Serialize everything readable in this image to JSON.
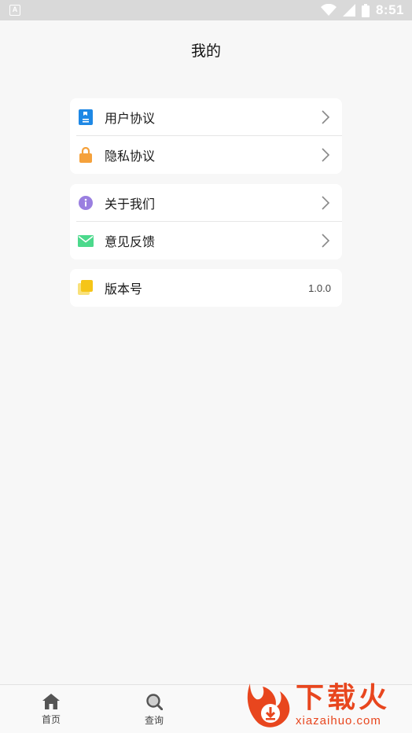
{
  "status_bar": {
    "time": "8:51",
    "icons": [
      "app-notification-icon",
      "wifi-icon",
      "cell-signal-icon",
      "battery-icon"
    ]
  },
  "page": {
    "title": "我的"
  },
  "menu_groups": [
    {
      "items": [
        {
          "label": "用户协议",
          "icon": "book-icon",
          "icon_color": "#1e88e5"
        },
        {
          "label": "隐私协议",
          "icon": "lock-icon",
          "icon_color": "#f5a13b"
        }
      ]
    },
    {
      "items": [
        {
          "label": "关于我们",
          "icon": "info-icon",
          "icon_color": "#9a7fe0"
        },
        {
          "label": "意见反馈",
          "icon": "mail-icon",
          "icon_color": "#4cd98c"
        }
      ]
    },
    {
      "items": [
        {
          "label": "版本号",
          "icon": "layers-icon",
          "icon_color": "#f5c518",
          "value": "1.0.0"
        }
      ]
    }
  ],
  "tab_bar": {
    "tabs": [
      {
        "label": "首页",
        "icon": "home-icon"
      },
      {
        "label": "查询",
        "icon": "search-icon"
      }
    ]
  },
  "watermark": {
    "cn": "下载火",
    "en": "xiazaihuo.com",
    "color": "#e8461e"
  }
}
